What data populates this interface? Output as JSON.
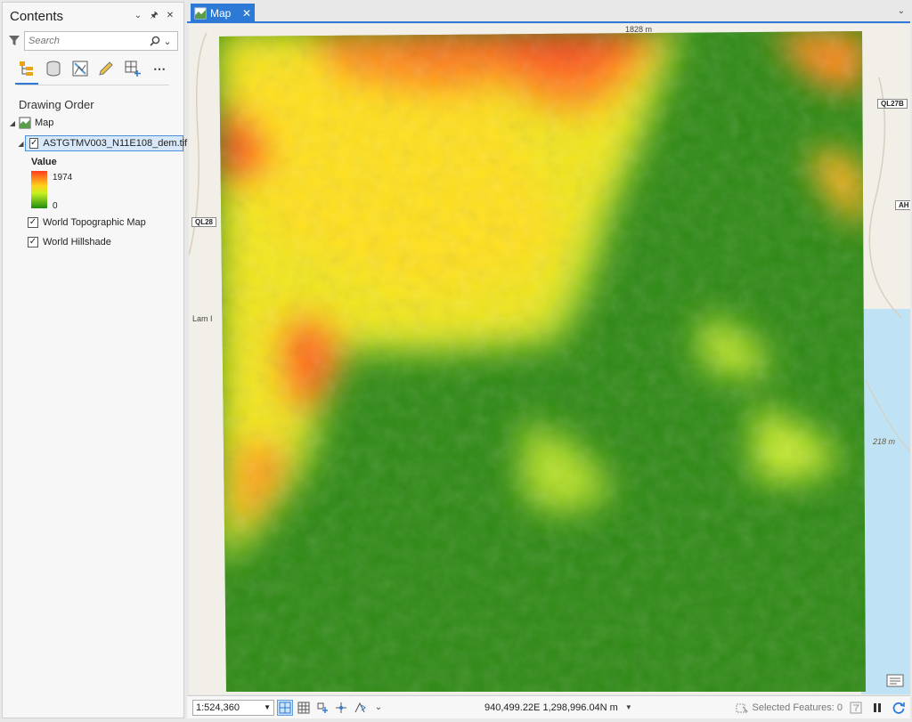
{
  "contents": {
    "title": "Contents",
    "search_placeholder": "Search",
    "drawing_order_label": "Drawing Order",
    "map_label": "Map",
    "layers": [
      {
        "name": "ASTGTMV003_N11E108_dem.tif",
        "checked": true,
        "selected": true
      },
      {
        "name": "World Topographic Map",
        "checked": true
      },
      {
        "name": "World Hillshade",
        "checked": true
      }
    ],
    "legend": {
      "title": "Value",
      "high": "1974",
      "low": "0"
    }
  },
  "map_tab": {
    "label": "Map"
  },
  "basemap_labels": {
    "top": "1828 m",
    "ql28": "QL28",
    "ql27b": "QL27B",
    "ah": "AH",
    "lam": "Lam I",
    "elev218": "218 m"
  },
  "statusbar": {
    "scale": "1:524,360",
    "coordinates": "940,499.22E 1,298,996.04N m",
    "selected_features": "Selected Features: 0"
  },
  "colors": {
    "accent": "#2d7ad6",
    "dem_high": "#ff3b1f",
    "dem_mid": "#ffd21a",
    "dem_low": "#1e8c12"
  }
}
